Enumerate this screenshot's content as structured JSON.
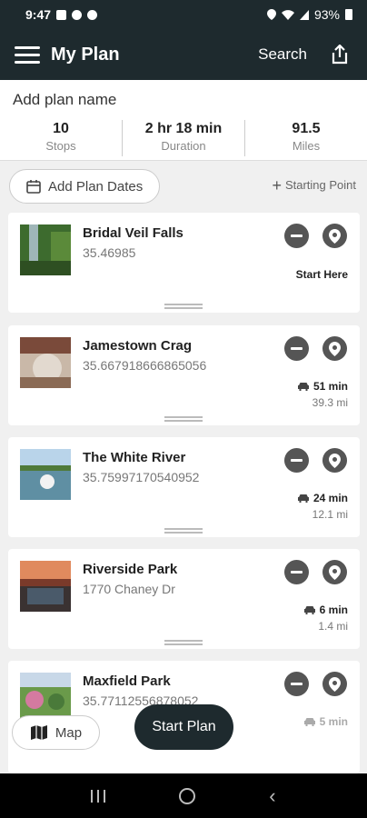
{
  "status_bar": {
    "time": "9:47",
    "battery": "93%"
  },
  "header": {
    "title": "My Plan",
    "search_label": "Search"
  },
  "plan": {
    "name_placeholder": "Add plan name",
    "stats": [
      {
        "value": "10",
        "label": "Stops"
      },
      {
        "value": "2 hr 18 min",
        "label": "Duration"
      },
      {
        "value": "91.5",
        "label": "Miles"
      }
    ]
  },
  "controls": {
    "dates_label": "Add Plan Dates",
    "starting_point_label": "Starting Point"
  },
  "stops": [
    {
      "name": "Bridal Veil Falls",
      "sub": "35.46985",
      "note": "Start Here"
    },
    {
      "name": "Jamestown Crag",
      "sub": "35.667918666865056",
      "drive_time": "51 min",
      "drive_distance": "39.3 mi"
    },
    {
      "name": "The White River",
      "sub": "35.75997170540952",
      "drive_time": "24 min",
      "drive_distance": "12.1 mi"
    },
    {
      "name": "Riverside Park",
      "sub": "1770 Chaney Dr",
      "drive_time": "6 min",
      "drive_distance": "1.4 mi"
    },
    {
      "name": "Maxfield Park",
      "sub": "35.77112556878052",
      "drive_time": "5 min"
    }
  ],
  "fabs": {
    "map_label": "Map",
    "start_label": "Start Plan"
  },
  "colors": {
    "header_bg": "#1e2a2e",
    "action_gray": "#555555"
  }
}
